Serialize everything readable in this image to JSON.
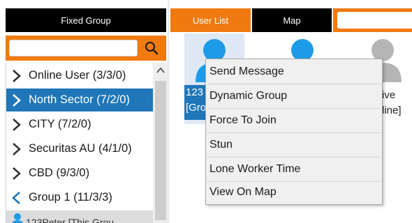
{
  "left_panel": {
    "header": "Fixed Group",
    "search": {
      "value": "",
      "placeholder": ""
    },
    "tree": [
      {
        "label": "Online User (3/3/0)",
        "state": "collapsed",
        "selected": false
      },
      {
        "label": "North Sector (7/2/0)",
        "state": "collapsed",
        "selected": true
      },
      {
        "label": "CITY (7/2/0)",
        "state": "collapsed",
        "selected": false
      },
      {
        "label": "Securitas AU (4/1/0)",
        "state": "collapsed",
        "selected": false
      },
      {
        "label": "CBD (9/3/0)",
        "state": "collapsed",
        "selected": false
      },
      {
        "label": "Group 1 (11/3/3)",
        "state": "expanded",
        "selected": false
      },
      {
        "label": "123Peter [This Grou",
        "state": "child",
        "selected": false
      }
    ]
  },
  "right_panel": {
    "tabs": [
      {
        "label": "User List",
        "active": true
      },
      {
        "label": "Map",
        "active": false
      }
    ],
    "search": {
      "value": ""
    },
    "tiles": [
      {
        "line1": "123",
        "line2": "[Gro",
        "status": "online",
        "selected": true
      },
      {
        "line1": "",
        "line2": "",
        "status": "online",
        "selected": false
      },
      {
        "line1": "ive",
        "line2": "line]",
        "status": "offline",
        "selected": false
      }
    ]
  },
  "context_menu": {
    "items": [
      "Send Message",
      "Dynamic Group",
      "Force To Join",
      "Stun",
      "Lone Worker Time",
      "View On Map"
    ]
  },
  "colors": {
    "accent_orange": "#f07a0f",
    "header_black": "#000000",
    "selection_blue": "#1f76b8",
    "online_blue": "#1e9be8",
    "offline_gray": "#b5b5b5",
    "menu_bg": "#f0f0f0"
  },
  "icons": {
    "search": "search-icon",
    "collapsed": "chevron-right-icon",
    "expanded": "chevron-left-icon",
    "user": "user-avatar-icon",
    "scroll_up": "chevron-up-icon"
  }
}
